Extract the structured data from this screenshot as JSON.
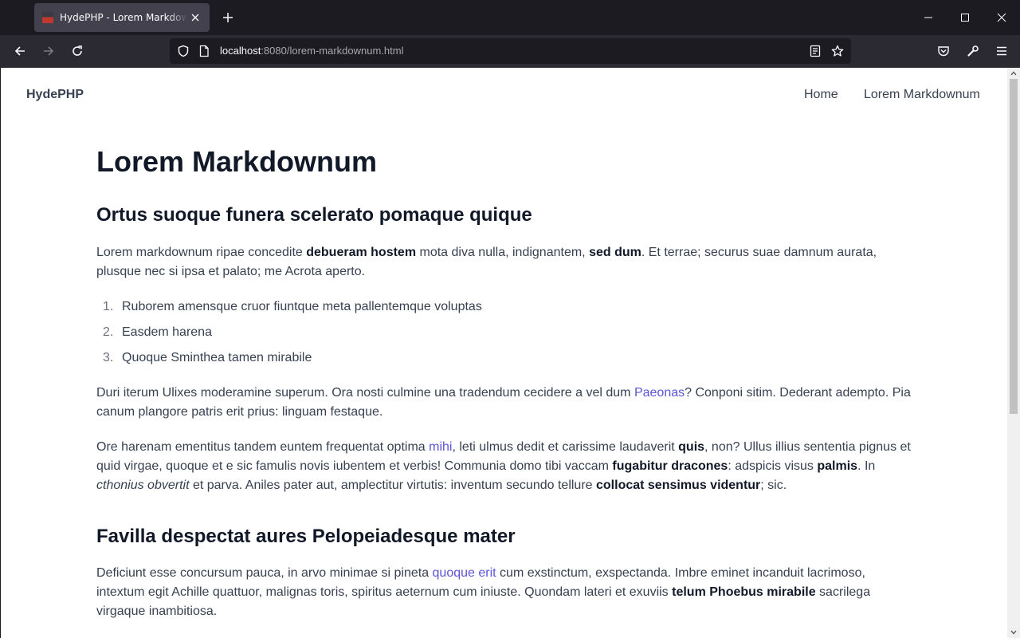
{
  "browser": {
    "tab": {
      "title": "HydePHP - Lorem Markdownum"
    },
    "url": {
      "host": "localhost",
      "rest": ":8080/lorem-markdownum.html"
    }
  },
  "site": {
    "brand": "HydePHP",
    "nav": [
      {
        "label": "Home"
      },
      {
        "label": "Lorem Markdownum"
      }
    ]
  },
  "article": {
    "h1": "Lorem Markdownum",
    "s1": {
      "heading": "Ortus suoque funera scelerato pomaque quique",
      "p1": {
        "t1": "Lorem markdownum ripae concedite ",
        "b1": "debueram hostem",
        "t2": " mota diva nulla, indignantem, ",
        "b2": "sed dum",
        "t3": ". Et terrae; securus suae damnum aurata, plusque nec si ipsa et palato; me Acrota aperto."
      },
      "list": [
        {
          "num": "1.",
          "text": "Ruborem amensque cruor fiuntque meta pallentemque voluptas"
        },
        {
          "num": "2.",
          "text": "Easdem harena"
        },
        {
          "num": "3.",
          "text": "Quoque Sminthea tamen mirabile"
        }
      ],
      "p2": {
        "t1": "Duri iterum Ulixes moderamine superum. Ora nosti culmine una tradendum cecidere a vel dum ",
        "a1": "Paeonas",
        "t2": "? Conponi sitim. Dederant adempto. Pia canum plangore patris erit prius: linguam festaque."
      },
      "p3": {
        "t1": "Ore harenam ementitus tandem euntem frequentat optima ",
        "a1": "mihi",
        "t2": ", leti ulmus dedit et carissime laudaverit ",
        "b1": "quis",
        "t3": ", non? Ullus illius sententia pignus et quid virgae, quoque et e sic famulis novis iubentem et verbis! Communia domo tibi vaccam ",
        "b2": "fugabitur dracones",
        "t4": ": adspicis visus ",
        "b3": "palmis",
        "t5": ". In ",
        "i1": "cthonius obvertit",
        "t6": " et parva. Aniles pater aut, amplectitur virtutis: inventum secundo tellure ",
        "b4": "collocat sensimus videntur",
        "t7": "; sic."
      }
    },
    "s2": {
      "heading": "Favilla despectat aures Pelopeiadesque mater",
      "p1": {
        "t1": "Deficiunt esse concursum pauca, in arvo minimae si pineta ",
        "a1": "quoque erit",
        "t2": " cum exstinctum, exspectanda. Imbre eminet incanduit lacrimoso, intextum egit Achille quattuor, malignas toris, spiritus aeternum cum iniuste. Quondam lateri et exuviis ",
        "b1": "telum Phoebus mirabile",
        "t3": " sacrilega virgaque inambitiosa."
      }
    }
  }
}
